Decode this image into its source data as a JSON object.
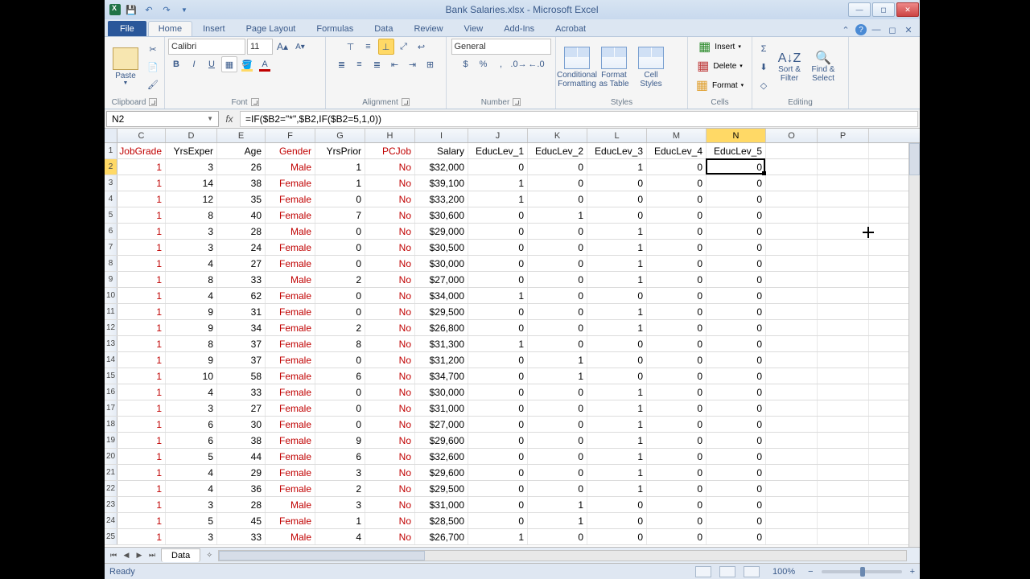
{
  "title": "Bank Salaries.xlsx - Microsoft Excel",
  "tabs": {
    "file": "File",
    "home": "Home",
    "insert": "Insert",
    "pagelayout": "Page Layout",
    "formulas": "Formulas",
    "data": "Data",
    "review": "Review",
    "view": "View",
    "addins": "Add-Ins",
    "acrobat": "Acrobat"
  },
  "ribbon": {
    "clipboard": {
      "paste": "Paste",
      "label": "Clipboard"
    },
    "font": {
      "name": "Calibri",
      "size": "11",
      "label": "Font"
    },
    "alignment": {
      "label": "Alignment"
    },
    "number": {
      "format": "General",
      "label": "Number"
    },
    "styles": {
      "cond": "Conditional Formatting",
      "table": "Format as Table",
      "cell": "Cell Styles",
      "label": "Styles"
    },
    "cells": {
      "insert": "Insert",
      "delete": "Delete",
      "format": "Format",
      "label": "Cells"
    },
    "editing": {
      "sort": "Sort & Filter",
      "find": "Find & Select",
      "label": "Editing"
    }
  },
  "namebox": "N2",
  "formula": "=IF($B2=\"*\",$B2,IF($B2=5,1,0))",
  "cols": [
    "C",
    "D",
    "E",
    "F",
    "G",
    "H",
    "I",
    "J",
    "K",
    "L",
    "M",
    "N",
    "O",
    "P"
  ],
  "headers": {
    "C": "JobGrade",
    "D": "YrsExper",
    "E": "Age",
    "F": "Gender",
    "G": "YrsPrior",
    "H": "PCJob",
    "I": "Salary",
    "J": "EducLev_1",
    "K": "EducLev_2",
    "L": "EducLev_3",
    "M": "EducLev_4",
    "N": "EducLev_5"
  },
  "headerRed": [
    "C",
    "F",
    "H"
  ],
  "rows": [
    {
      "n": 2,
      "C": 1,
      "D": 3,
      "E": 26,
      "F": "Male",
      "G": 1,
      "H": "No",
      "I": "$32,000",
      "J": 0,
      "K": 0,
      "L": 1,
      "M": 0,
      "N": 0
    },
    {
      "n": 3,
      "C": 1,
      "D": 14,
      "E": 38,
      "F": "Female",
      "G": 1,
      "H": "No",
      "I": "$39,100",
      "J": 1,
      "K": 0,
      "L": 0,
      "M": 0,
      "N": 0
    },
    {
      "n": 4,
      "C": 1,
      "D": 12,
      "E": 35,
      "F": "Female",
      "G": 0,
      "H": "No",
      "I": "$33,200",
      "J": 1,
      "K": 0,
      "L": 0,
      "M": 0,
      "N": 0
    },
    {
      "n": 5,
      "C": 1,
      "D": 8,
      "E": 40,
      "F": "Female",
      "G": 7,
      "H": "No",
      "I": "$30,600",
      "J": 0,
      "K": 1,
      "L": 0,
      "M": 0,
      "N": 0
    },
    {
      "n": 6,
      "C": 1,
      "D": 3,
      "E": 28,
      "F": "Male",
      "G": 0,
      "H": "No",
      "I": "$29,000",
      "J": 0,
      "K": 0,
      "L": 1,
      "M": 0,
      "N": 0
    },
    {
      "n": 7,
      "C": 1,
      "D": 3,
      "E": 24,
      "F": "Female",
      "G": 0,
      "H": "No",
      "I": "$30,500",
      "J": 0,
      "K": 0,
      "L": 1,
      "M": 0,
      "N": 0
    },
    {
      "n": 8,
      "C": 1,
      "D": 4,
      "E": 27,
      "F": "Female",
      "G": 0,
      "H": "No",
      "I": "$30,000",
      "J": 0,
      "K": 0,
      "L": 1,
      "M": 0,
      "N": 0
    },
    {
      "n": 9,
      "C": 1,
      "D": 8,
      "E": 33,
      "F": "Male",
      "G": 2,
      "H": "No",
      "I": "$27,000",
      "J": 0,
      "K": 0,
      "L": 1,
      "M": 0,
      "N": 0
    },
    {
      "n": 10,
      "C": 1,
      "D": 4,
      "E": 62,
      "F": "Female",
      "G": 0,
      "H": "No",
      "I": "$34,000",
      "J": 1,
      "K": 0,
      "L": 0,
      "M": 0,
      "N": 0
    },
    {
      "n": 11,
      "C": 1,
      "D": 9,
      "E": 31,
      "F": "Female",
      "G": 0,
      "H": "No",
      "I": "$29,500",
      "J": 0,
      "K": 0,
      "L": 1,
      "M": 0,
      "N": 0
    },
    {
      "n": 12,
      "C": 1,
      "D": 9,
      "E": 34,
      "F": "Female",
      "G": 2,
      "H": "No",
      "I": "$26,800",
      "J": 0,
      "K": 0,
      "L": 1,
      "M": 0,
      "N": 0
    },
    {
      "n": 13,
      "C": 1,
      "D": 8,
      "E": 37,
      "F": "Female",
      "G": 8,
      "H": "No",
      "I": "$31,300",
      "J": 1,
      "K": 0,
      "L": 0,
      "M": 0,
      "N": 0
    },
    {
      "n": 14,
      "C": 1,
      "D": 9,
      "E": 37,
      "F": "Female",
      "G": 0,
      "H": "No",
      "I": "$31,200",
      "J": 0,
      "K": 1,
      "L": 0,
      "M": 0,
      "N": 0
    },
    {
      "n": 15,
      "C": 1,
      "D": 10,
      "E": 58,
      "F": "Female",
      "G": 6,
      "H": "No",
      "I": "$34,700",
      "J": 0,
      "K": 1,
      "L": 0,
      "M": 0,
      "N": 0
    },
    {
      "n": 16,
      "C": 1,
      "D": 4,
      "E": 33,
      "F": "Female",
      "G": 0,
      "H": "No",
      "I": "$30,000",
      "J": 0,
      "K": 0,
      "L": 1,
      "M": 0,
      "N": 0
    },
    {
      "n": 17,
      "C": 1,
      "D": 3,
      "E": 27,
      "F": "Female",
      "G": 0,
      "H": "No",
      "I": "$31,000",
      "J": 0,
      "K": 0,
      "L": 1,
      "M": 0,
      "N": 0
    },
    {
      "n": 18,
      "C": 1,
      "D": 6,
      "E": 30,
      "F": "Female",
      "G": 0,
      "H": "No",
      "I": "$27,000",
      "J": 0,
      "K": 0,
      "L": 1,
      "M": 0,
      "N": 0
    },
    {
      "n": 19,
      "C": 1,
      "D": 6,
      "E": 38,
      "F": "Female",
      "G": 9,
      "H": "No",
      "I": "$29,600",
      "J": 0,
      "K": 0,
      "L": 1,
      "M": 0,
      "N": 0
    },
    {
      "n": 20,
      "C": 1,
      "D": 5,
      "E": 44,
      "F": "Female",
      "G": 6,
      "H": "No",
      "I": "$32,600",
      "J": 0,
      "K": 0,
      "L": 1,
      "M": 0,
      "N": 0
    },
    {
      "n": 21,
      "C": 1,
      "D": 4,
      "E": 29,
      "F": "Female",
      "G": 3,
      "H": "No",
      "I": "$29,600",
      "J": 0,
      "K": 0,
      "L": 1,
      "M": 0,
      "N": 0
    },
    {
      "n": 22,
      "C": 1,
      "D": 4,
      "E": 36,
      "F": "Female",
      "G": 2,
      "H": "No",
      "I": "$29,500",
      "J": 0,
      "K": 0,
      "L": 1,
      "M": 0,
      "N": 0
    },
    {
      "n": 23,
      "C": 1,
      "D": 3,
      "E": 28,
      "F": "Male",
      "G": 3,
      "H": "No",
      "I": "$31,000",
      "J": 0,
      "K": 1,
      "L": 0,
      "M": 0,
      "N": 0
    },
    {
      "n": 24,
      "C": 1,
      "D": 5,
      "E": 45,
      "F": "Female",
      "G": 1,
      "H": "No",
      "I": "$28,500",
      "J": 0,
      "K": 1,
      "L": 0,
      "M": 0,
      "N": 0
    },
    {
      "n": 25,
      "C": 1,
      "D": 3,
      "E": 33,
      "F": "Male",
      "G": 4,
      "H": "No",
      "I": "$26,700",
      "J": 1,
      "K": 0,
      "L": 0,
      "M": 0,
      "N": 0
    }
  ],
  "sheet": "Data",
  "status": "Ready",
  "zoom": "100%"
}
